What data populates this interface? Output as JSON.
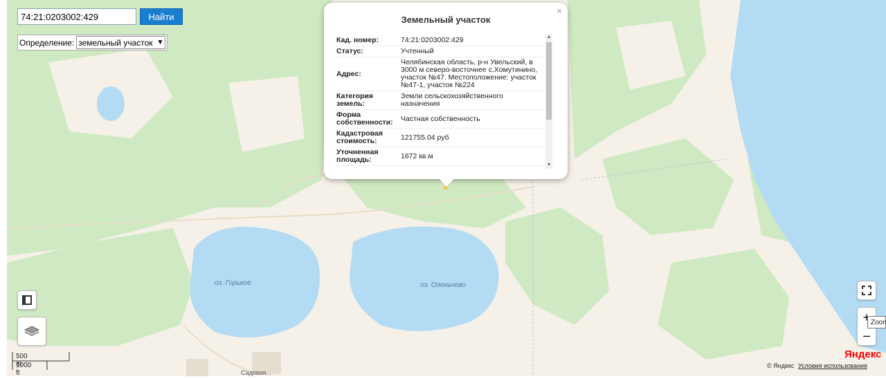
{
  "search": {
    "value": "74:21:0203002:429",
    "button_label": "Найти"
  },
  "definition": {
    "label": "Определение:",
    "selected": "земельный участок"
  },
  "popup": {
    "title": "Земельный участок",
    "close": "×",
    "rows": [
      {
        "key": "Кад. номер",
        "value": "74:21:0203002:429"
      },
      {
        "key": "Статус",
        "value": "Учтенный"
      },
      {
        "key": "Адрес",
        "value": "Челябинская область, р-н Увельский, в 3000 м северо-восточнее с.Хомутинино, участок №47. Местоположение: участок №47-1, участок №224"
      },
      {
        "key": "Категория земель",
        "value": "Земли сельскохозяйственного назначения"
      },
      {
        "key": "Форма собственности",
        "value": "Частная собственность"
      },
      {
        "key": "Кадастровая стоимость",
        "value": "121755.04 руб"
      },
      {
        "key": "Уточненная площадь",
        "value": "1672 кв.м"
      }
    ]
  },
  "map": {
    "lakes": [
      {
        "name": "оз. Горькое"
      },
      {
        "name": "оз. Оленьчево"
      }
    ],
    "street_label": "Садовая...",
    "scale": {
      "metric": "500 m",
      "imperial": "1000 ft"
    },
    "attribution": {
      "copyright": "© Яндекс",
      "terms": "Условия использования"
    },
    "logo": "Яндекс",
    "zoom_plus": "+",
    "zoom_minus": "–",
    "tooltip": "Zoom",
    "colors": {
      "water": "#b3dbf4",
      "forest": "#cfe9c2",
      "land": "#f5f1e8",
      "accent": "#1a7ed0",
      "logo_red": "#f00"
    }
  }
}
